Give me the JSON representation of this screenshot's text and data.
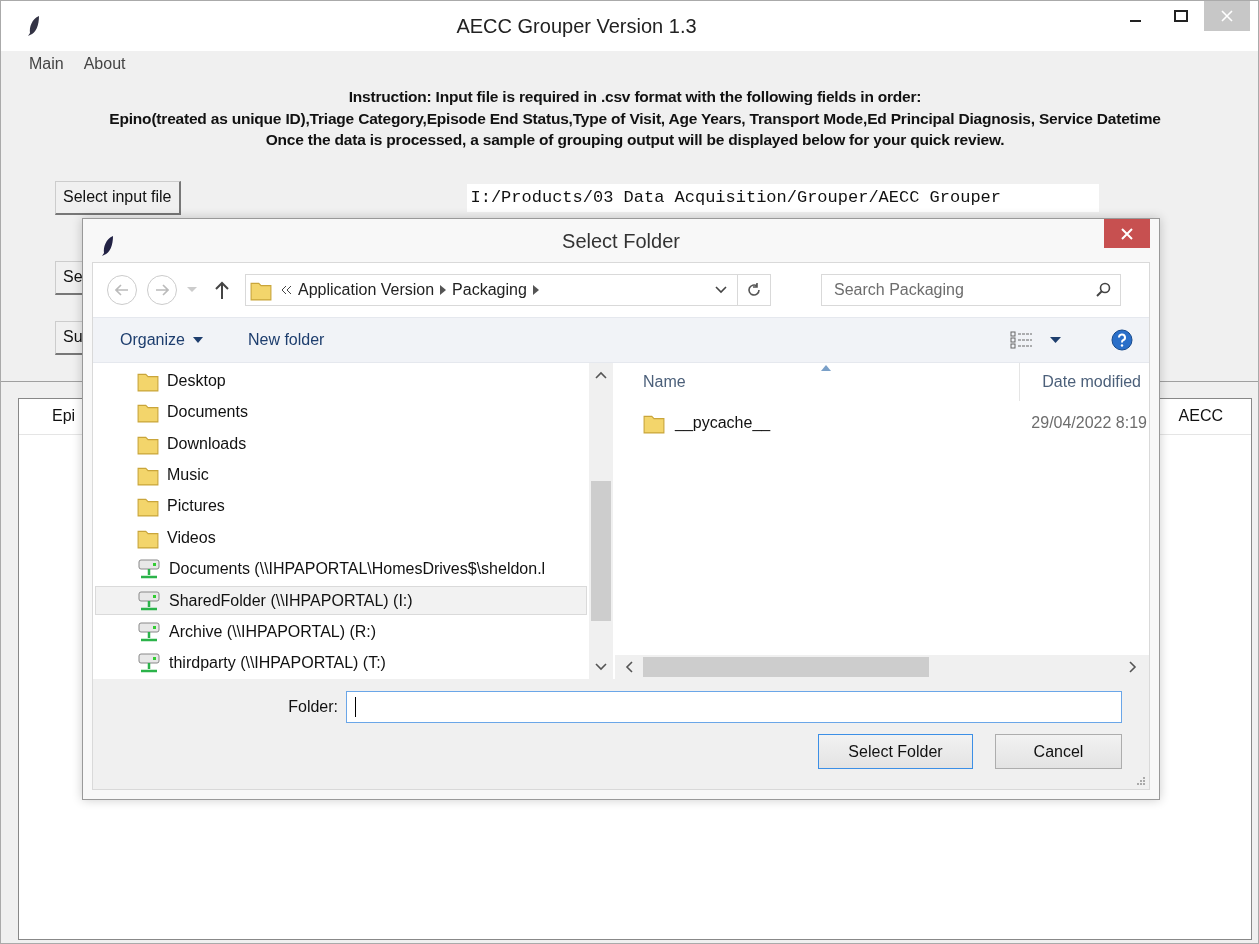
{
  "window": {
    "title": "AECC Grouper Version 1.3"
  },
  "menu": [
    {
      "label": "Main"
    },
    {
      "label": "About"
    }
  ],
  "instructions": [
    "Instruction: Input file is required in .csv format with the following fields in order:",
    "Epino(treated as unique ID),Triage Category,Episode End Status,Type of Visit, Age Years, Transport Mode,Ed Principal Diagnosis, Service Datetime",
    "Once the data is processed, a sample of grouping output will be displayed below for your quick review."
  ],
  "input_button": "Select input file",
  "input_path": "I:/Products/03 Data Acquisition/Grouper/AECC Grouper",
  "side_buttons": [
    "Se",
    "Su"
  ],
  "table": {
    "columns": [
      {
        "label": "Epi"
      },
      {
        "label": "AECC"
      }
    ]
  },
  "dialog": {
    "title": "Select Folder",
    "breadcrumb": [
      "Application Version",
      "Packaging"
    ],
    "search": {
      "placeholder": "Search Packaging"
    },
    "toolbar": [
      "Organize",
      "New folder"
    ],
    "nav_items": [
      {
        "label": "Desktop",
        "kind": "library",
        "selected": false
      },
      {
        "label": "Documents",
        "kind": "library",
        "selected": false
      },
      {
        "label": "Downloads",
        "kind": "library",
        "selected": false
      },
      {
        "label": "Music",
        "kind": "library",
        "selected": false
      },
      {
        "label": "Pictures",
        "kind": "library",
        "selected": false
      },
      {
        "label": "Videos",
        "kind": "library",
        "selected": false
      },
      {
        "label": "Documents (\\\\IHPAPORTAL\\HomesDrives$\\sheldon.l",
        "kind": "drive",
        "selected": false
      },
      {
        "label": "SharedFolder (\\\\IHPAPORTAL) (I:)",
        "kind": "drive",
        "selected": true
      },
      {
        "label": "Archive (\\\\IHPAPORTAL) (R:)",
        "kind": "drive",
        "selected": false
      },
      {
        "label": "thirdparty (\\\\IHPAPORTAL) (T:)",
        "kind": "drive",
        "selected": false
      }
    ],
    "columns": [
      "Name",
      "Date modified"
    ],
    "files": [
      {
        "name": "__pycache__",
        "date_modified": "29/04/2022 8:19"
      }
    ],
    "folder_label": "Folder:",
    "folder_focused": true,
    "buttons": [
      {
        "label": "Select Folder",
        "default": true
      },
      {
        "label": "Cancel",
        "default": false
      }
    ]
  }
}
